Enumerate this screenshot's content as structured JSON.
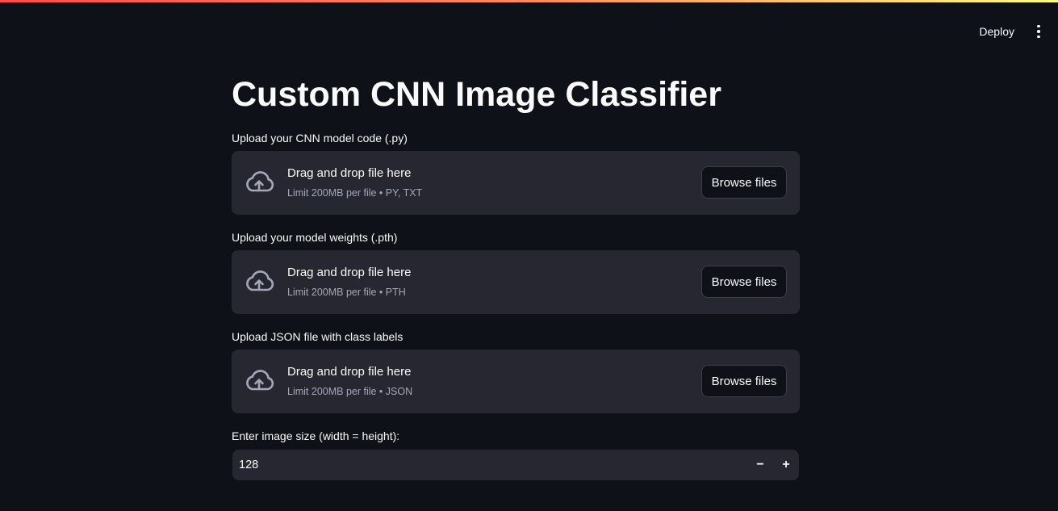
{
  "header": {
    "deploy_label": "Deploy",
    "menu_icon": "more-vertical-icon"
  },
  "page": {
    "title": "Custom CNN Image Classifier"
  },
  "uploaders": [
    {
      "label": "Upload your CNN model code (.py)",
      "drop_text": "Drag and drop file here",
      "limit_text": "Limit 200MB per file • PY, TXT",
      "button_label": "Browse files",
      "icon": "cloud-upload-icon"
    },
    {
      "label": "Upload your model weights (.pth)",
      "drop_text": "Drag and drop file here",
      "limit_text": "Limit 200MB per file • PTH",
      "button_label": "Browse files",
      "icon": "cloud-upload-icon"
    },
    {
      "label": "Upload JSON file with class labels",
      "drop_text": "Drag and drop file here",
      "limit_text": "Limit 200MB per file • JSON",
      "button_label": "Browse files",
      "icon": "cloud-upload-icon"
    }
  ],
  "image_size": {
    "label": "Enter image size (width = height):",
    "value": "128",
    "minus_symbol": "−",
    "plus_symbol": "+"
  },
  "colors": {
    "background": "#0e1117",
    "widget_background": "#262730",
    "text": "#fafafa",
    "muted_text": "#a3a8b8",
    "accent_gradient_start": "#ff4b4b",
    "accent_gradient_end": "#fffd80"
  }
}
